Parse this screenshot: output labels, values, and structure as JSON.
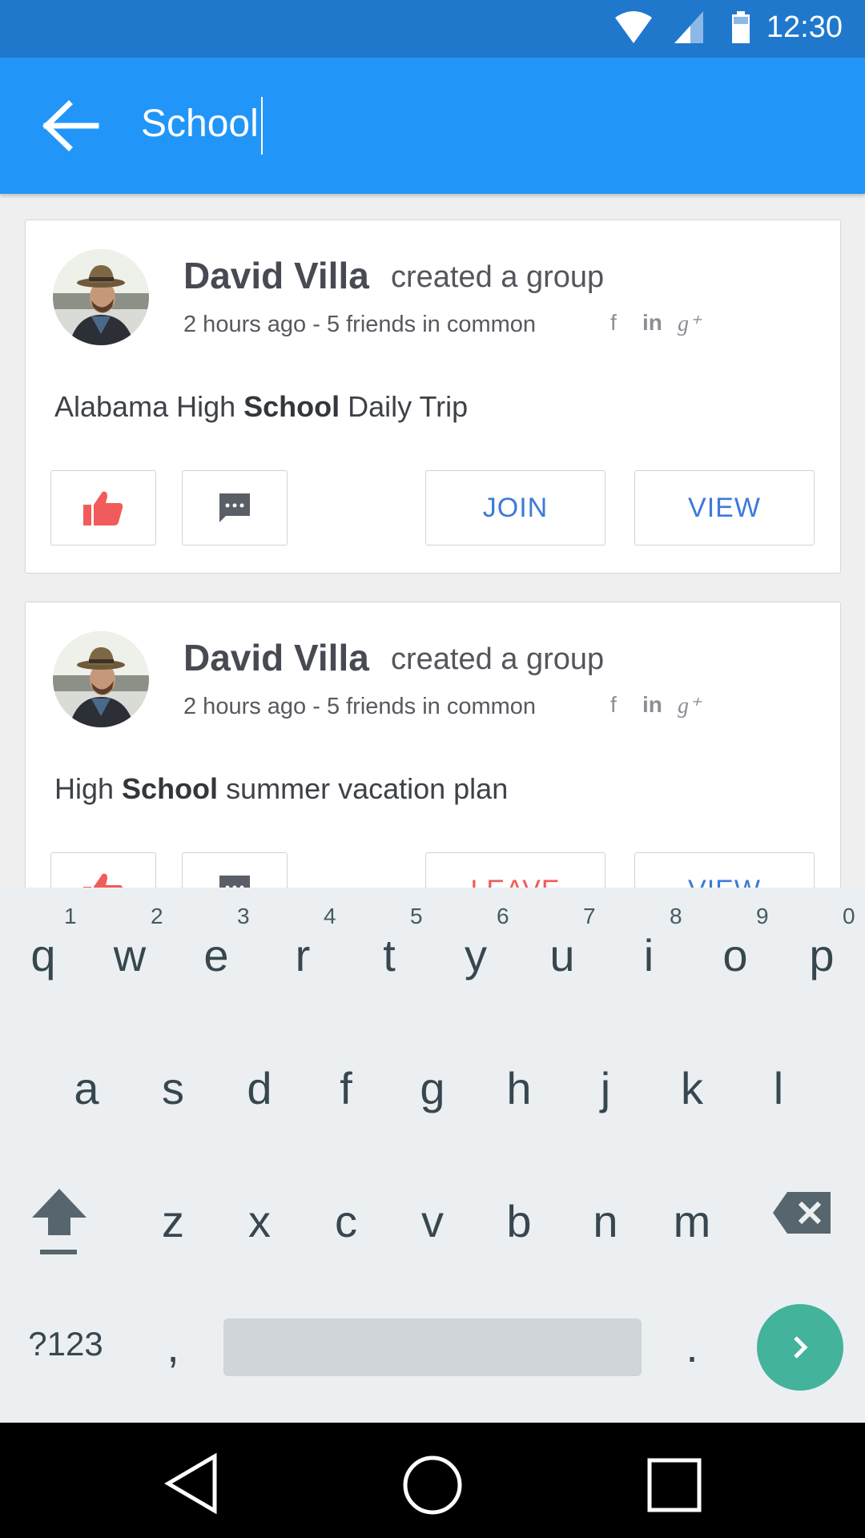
{
  "status_bar": {
    "time": "12:30"
  },
  "search": {
    "query": "School"
  },
  "cards": [
    {
      "author": "David Villa",
      "action": "created a group",
      "meta": "2 hours ago - 5 friends in common",
      "social": {
        "facebook": "f",
        "linkedin": "in",
        "googleplus": "g⁺"
      },
      "post_before": "Alabama High ",
      "post_highlight": "School",
      "post_after": " Daily Trip",
      "primary_button": "JOIN",
      "secondary_button": "VIEW"
    },
    {
      "author": "David Villa",
      "action": "created a group",
      "meta": "2 hours ago - 5 friends in common",
      "social": {
        "facebook": "f",
        "linkedin": "in",
        "googleplus": "g⁺"
      },
      "post_before": "High ",
      "post_highlight": "School",
      "post_after": " summer vacation plan",
      "primary_button": "LEAVE",
      "secondary_button": "VIEW"
    }
  ],
  "keyboard": {
    "row1": [
      "q",
      "w",
      "e",
      "r",
      "t",
      "y",
      "u",
      "i",
      "o",
      "p"
    ],
    "row1_hints": [
      "1",
      "2",
      "3",
      "4",
      "5",
      "6",
      "7",
      "8",
      "9",
      "0"
    ],
    "row2": [
      "a",
      "s",
      "d",
      "f",
      "g",
      "h",
      "j",
      "k",
      "l"
    ],
    "row3": [
      "z",
      "x",
      "c",
      "v",
      "b",
      "n",
      "m"
    ],
    "symbols_key": "?123",
    "comma": ",",
    "period": "."
  },
  "colors": {
    "app_bar": "#2196f8",
    "status_bar": "#1f78cc",
    "like_icon": "#f25b5b",
    "link_blue": "#3d7ad9",
    "enter_key": "#43b39c"
  }
}
